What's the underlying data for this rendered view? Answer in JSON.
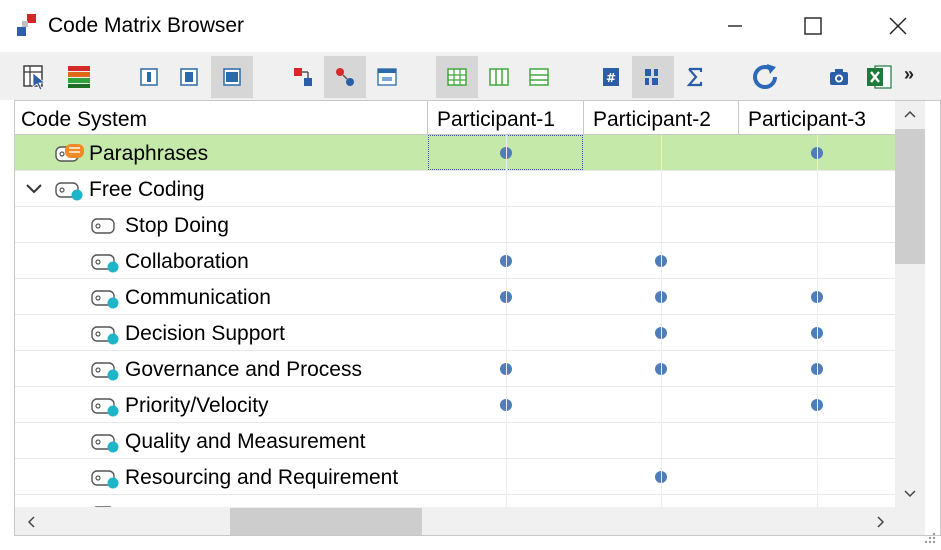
{
  "window": {
    "title": "Code Matrix Browser"
  },
  "toolbar": {
    "more_label": "»",
    "buttons": [
      {
        "name": "select-cursor-icon",
        "active": false
      },
      {
        "name": "code-colors-icon",
        "active": false
      },
      {
        "name": "doc-view-1-icon",
        "active": false
      },
      {
        "name": "doc-view-2-icon",
        "active": false
      },
      {
        "name": "doc-view-3-icon",
        "active": true
      },
      {
        "name": "code-link-icon",
        "active": false
      },
      {
        "name": "code-hierarchy-icon",
        "active": true
      },
      {
        "name": "number-123-icon",
        "active": false
      },
      {
        "name": "grid-view-icon",
        "active": true
      },
      {
        "name": "column-view-icon",
        "active": false
      },
      {
        "name": "row-view-icon",
        "active": false
      },
      {
        "name": "hash-icon",
        "active": false
      },
      {
        "name": "binary-icon",
        "active": true
      },
      {
        "name": "sigma-icon",
        "active": false
      },
      {
        "name": "refresh-icon",
        "active": false
      },
      {
        "name": "camera-icon",
        "active": false
      },
      {
        "name": "excel-icon",
        "active": false
      }
    ]
  },
  "matrix": {
    "header_code_system": "Code System",
    "columns": [
      "Participant-1",
      "Participant-2",
      "Participant-3"
    ],
    "rows": [
      {
        "label": "Paraphrases",
        "level": 0,
        "icon": "paraphrase",
        "expanded": false,
        "highlight": true,
        "hits": [
          true,
          false,
          true
        ]
      },
      {
        "label": "Free Coding",
        "level": 0,
        "icon": "code-parent",
        "expanded": true,
        "highlight": false,
        "hits": [
          false,
          false,
          false
        ]
      },
      {
        "label": "Stop Doing",
        "level": 1,
        "icon": "code-empty",
        "expanded": false,
        "highlight": false,
        "hits": [
          false,
          false,
          false
        ]
      },
      {
        "label": "Collaboration",
        "level": 1,
        "icon": "code",
        "expanded": false,
        "highlight": false,
        "hits": [
          true,
          true,
          false
        ]
      },
      {
        "label": "Communication",
        "level": 1,
        "icon": "code",
        "expanded": false,
        "highlight": false,
        "hits": [
          true,
          true,
          true
        ]
      },
      {
        "label": "Decision Support",
        "level": 1,
        "icon": "code",
        "expanded": false,
        "highlight": false,
        "hits": [
          false,
          true,
          true
        ]
      },
      {
        "label": "Governance and Process",
        "level": 1,
        "icon": "code",
        "expanded": false,
        "highlight": false,
        "hits": [
          true,
          true,
          true
        ]
      },
      {
        "label": "Priority/Velocity",
        "level": 1,
        "icon": "code",
        "expanded": false,
        "highlight": false,
        "hits": [
          true,
          false,
          true
        ]
      },
      {
        "label": "Quality and Measurement",
        "level": 1,
        "icon": "code",
        "expanded": false,
        "highlight": false,
        "hits": [
          false,
          false,
          false
        ]
      },
      {
        "label": "Resourcing and Requirement",
        "level": 1,
        "icon": "code",
        "expanded": false,
        "highlight": false,
        "hits": [
          false,
          true,
          false
        ]
      },
      {
        "label": "",
        "level": 1,
        "icon": "code",
        "expanded": false,
        "highlight": false,
        "hits": [
          true,
          true,
          true
        ]
      }
    ]
  },
  "colors": {
    "highlight_row": "#c5e9a8",
    "dot": "#4f7db8",
    "code_teal": "#1fb5c9",
    "paraphrase_orange": "#f08a24"
  }
}
